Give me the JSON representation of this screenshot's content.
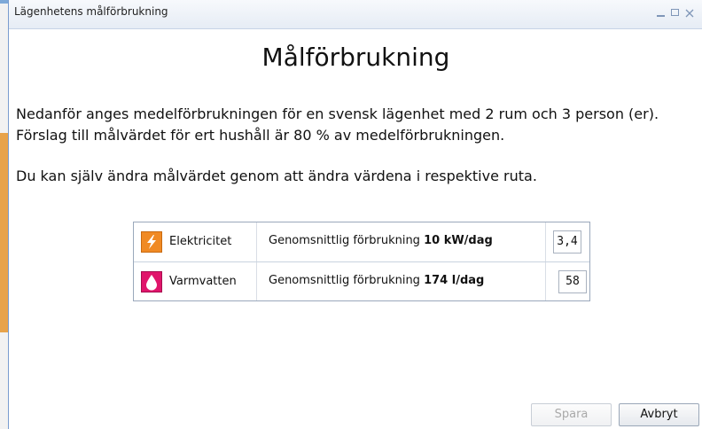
{
  "window": {
    "title": "Lägenhetens målförbrukning"
  },
  "main": {
    "heading": "Målförbrukning",
    "paragraph1": "Nedanför anges medelförbrukningen för en svensk lägenhet med 2 rum och 3 person (er).",
    "paragraph2": "Förslag till målvärdet för ert hushåll är 80 % av medelförbrukningen.",
    "paragraph3": "Du kan själv ändra målvärdet genom att ändra värdena i respektive ruta."
  },
  "table": {
    "rows": [
      {
        "icon": "electricity-icon",
        "name": "Elektricitet",
        "desc_prefix": "Genomsnittlig förbrukning ",
        "desc_value": "10 kW/dag",
        "value": "3,4",
        "color": "#f08a24"
      },
      {
        "icon": "water-drop-icon",
        "name": "Varmvatten",
        "desc_prefix": "Genomsnittlig förbrukning ",
        "desc_value": "174 l/dag",
        "value": "58",
        "color": "#e0156b"
      }
    ]
  },
  "buttons": {
    "save": "Spara",
    "cancel": "Avbryt"
  }
}
